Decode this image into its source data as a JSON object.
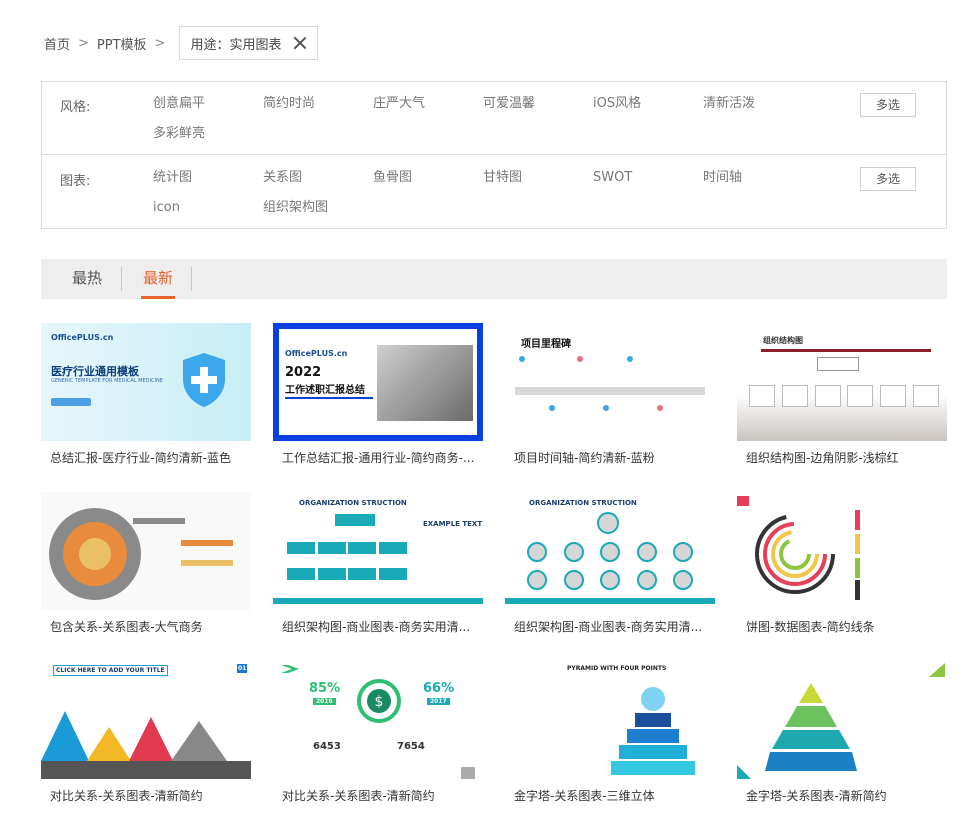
{
  "breadcrumb": {
    "home": "首页",
    "sep": ">",
    "ppt": "PPT模板",
    "chip_label": "用途：实用图表"
  },
  "filters": {
    "style": {
      "label": "风格:",
      "options": [
        "创意扁平",
        "简约时尚",
        "庄严大气",
        "可爱温馨",
        "iOS风格",
        "清新活泼",
        "多彩鲜亮"
      ],
      "multi": "多选"
    },
    "chart": {
      "label": "图表:",
      "options": [
        "统计图",
        "关系图",
        "鱼骨图",
        "甘特图",
        "SWOT",
        "时间轴",
        "icon",
        "组织架构图"
      ],
      "multi": "多选"
    }
  },
  "tabs": {
    "hot": "最热",
    "new": "最新"
  },
  "cards": [
    {
      "caption": "总结汇报-医疗行业-简约清新-蓝色",
      "thumb_text": [
        "OfficePLUS.cn",
        "医疗行业通用模板",
        "GENERIC TEMPLATE FOR MEDICAL MEDICINE"
      ]
    },
    {
      "caption": "工作总结汇报-通用行业-简约商务-...",
      "thumb_text": [
        "OfficePLUS.cn",
        "2022",
        "工作述职汇报总结"
      ]
    },
    {
      "caption": "项目时间轴-简约清新-蓝粉",
      "thumb_text": [
        "项目里程碑"
      ]
    },
    {
      "caption": "组织结构图-边角阴影-浅棕红",
      "thumb_text": [
        "组织结构图"
      ]
    },
    {
      "caption": "包含关系-关系图表-大气商务",
      "thumb_text": []
    },
    {
      "caption": "组织架构图-商业图表-商务实用清...",
      "thumb_text": [
        "ORGANIZATION STRUCTION",
        "EXAMPLE TEXT"
      ]
    },
    {
      "caption": "组织架构图-商业图表-商务实用清...",
      "thumb_text": [
        "ORGANIZATION STRUCTION"
      ]
    },
    {
      "caption": "饼图-数据图表-简约线条",
      "thumb_text": []
    },
    {
      "caption": "对比关系-关系图表-清新简约",
      "thumb_text": [
        "CLICK HERE TO ADD YOUR TITLE",
        "01"
      ]
    },
    {
      "caption": "对比关系-关系图表-清新简约",
      "thumb_text": [
        "85%",
        "66%",
        "2016",
        "2017",
        "6453",
        "7654"
      ]
    },
    {
      "caption": "金字塔-关系图表-三维立体",
      "thumb_text": [
        "PYRAMID WITH FOUR POINTS"
      ]
    },
    {
      "caption": "金字塔-关系图表-清新简约",
      "thumb_text": []
    }
  ],
  "colors": {
    "accent": "#e8622b",
    "teal": "#1aa9b6",
    "blue": "#0a3fe0"
  }
}
